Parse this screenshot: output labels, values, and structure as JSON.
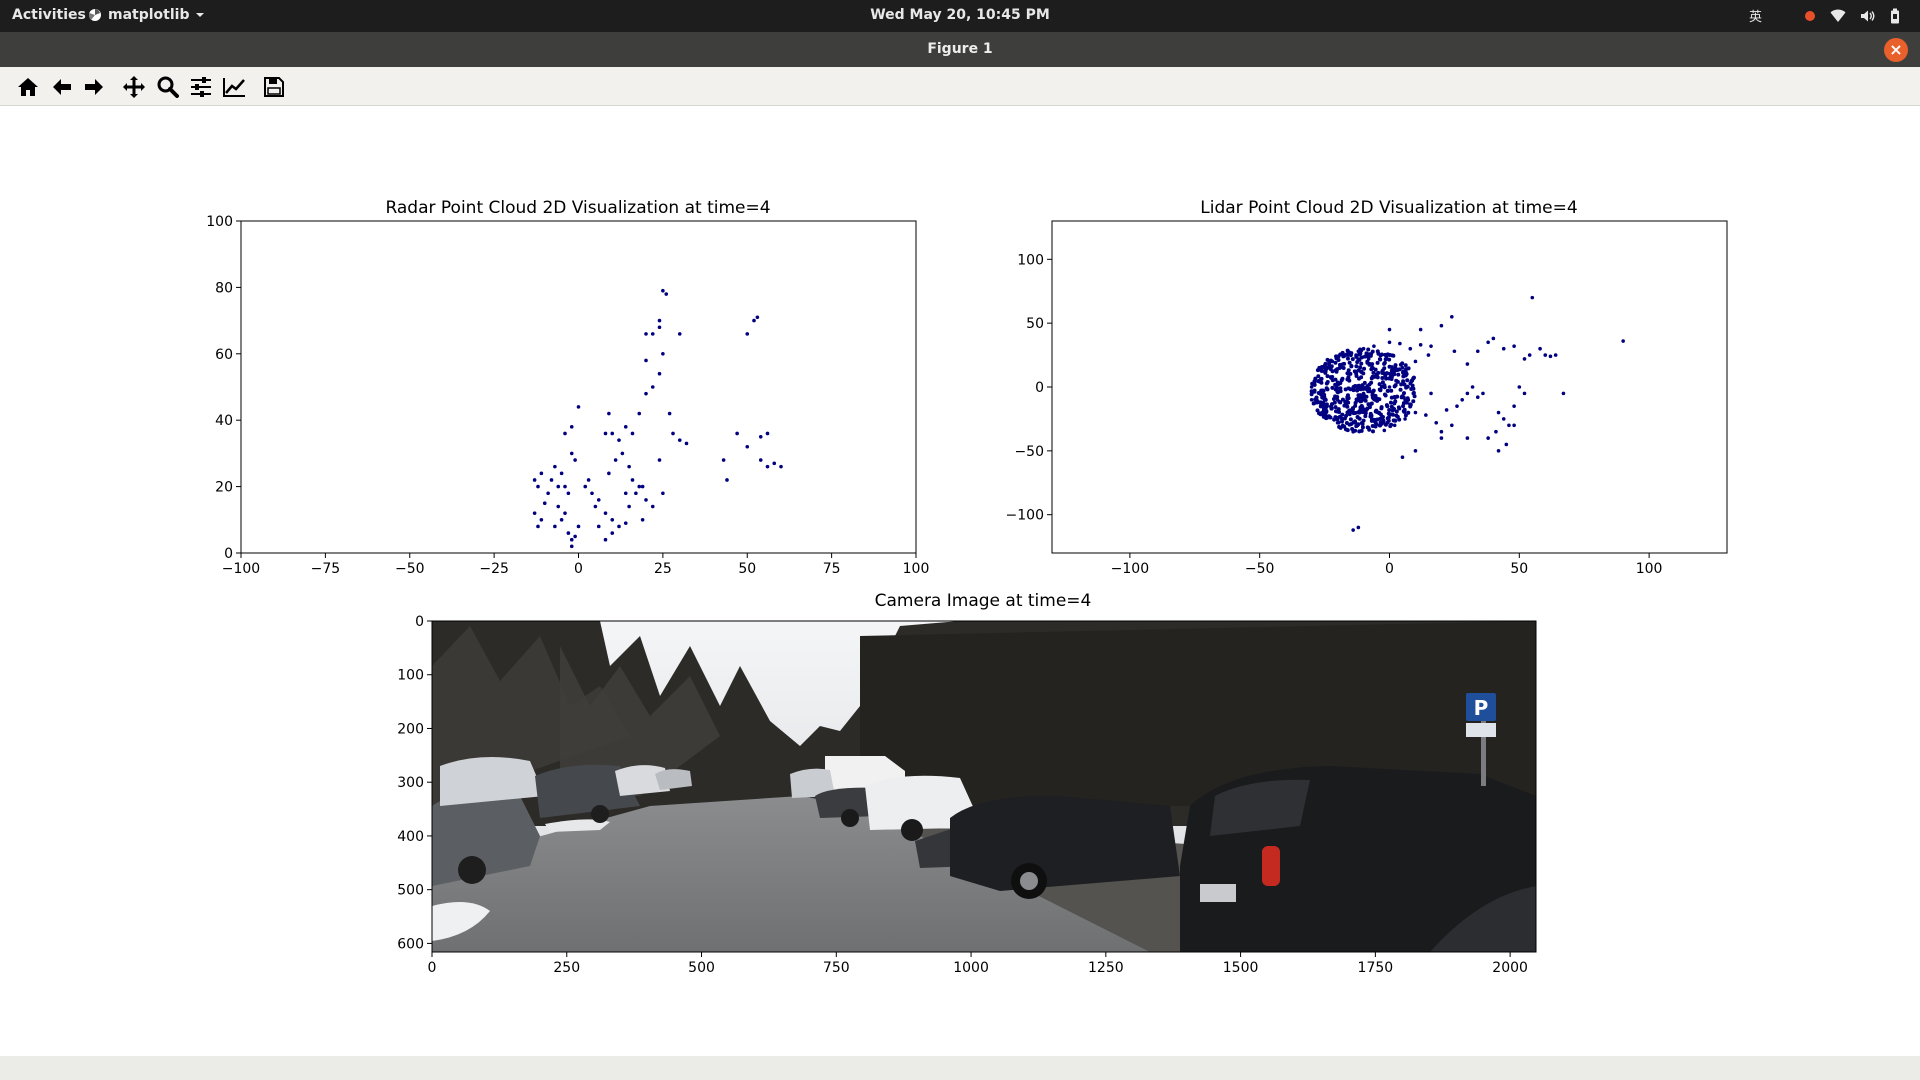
{
  "topbar": {
    "activities": "Activities",
    "app_name": "matplotlib",
    "clock": "Wed May 20, 10:45 PM",
    "input_method": "英",
    "icons": [
      "record-indicator-icon",
      "wifi-icon",
      "volume-icon",
      "battery-icon"
    ]
  },
  "window": {
    "title": "Figure 1",
    "close_symbol": "×"
  },
  "toolbar": {
    "buttons": [
      "home-icon",
      "back-arrow-icon",
      "forward-arrow-icon",
      "pan-icon",
      "zoom-icon",
      "subplots-config-icon",
      "axes-edit-icon",
      "save-icon"
    ]
  },
  "figure": {
    "radar_title": "Radar Point Cloud 2D Visualization at time=4",
    "lidar_title": "Lidar Point Cloud 2D Visualization at time=4",
    "camera_title": "Camera Image at time=4"
  },
  "chart_data": [
    {
      "type": "scatter",
      "title": "Radar Point Cloud 2D Visualization at time=4",
      "xlim": [
        -100,
        100
      ],
      "ylim": [
        0,
        100
      ],
      "xticks": [
        "−100",
        "−75",
        "−50",
        "−25",
        "0",
        "25",
        "50",
        "75",
        "100"
      ],
      "yticks": [
        "0",
        "20",
        "40",
        "60",
        "80",
        "100"
      ],
      "color": "#000080",
      "points": [
        [
          -12,
          8
        ],
        [
          -11,
          10
        ],
        [
          -13,
          12
        ],
        [
          -10,
          15
        ],
        [
          -9,
          18
        ],
        [
          -12,
          20
        ],
        [
          -8,
          22
        ],
        [
          -6,
          14
        ],
        [
          -5,
          10
        ],
        [
          -4,
          12
        ],
        [
          -3,
          6
        ],
        [
          -2,
          4
        ],
        [
          -2,
          2
        ],
        [
          -1,
          5
        ],
        [
          0,
          8
        ],
        [
          -3,
          18
        ],
        [
          -4,
          20
        ],
        [
          -5,
          24
        ],
        [
          -7,
          26
        ],
        [
          -2,
          30
        ],
        [
          -1,
          28
        ],
        [
          2,
          20
        ],
        [
          3,
          22
        ],
        [
          4,
          18
        ],
        [
          5,
          14
        ],
        [
          6,
          16
        ],
        [
          8,
          12
        ],
        [
          10,
          10
        ],
        [
          12,
          8
        ],
        [
          14,
          9
        ],
        [
          8,
          4
        ],
        [
          10,
          6
        ],
        [
          6,
          8
        ],
        [
          9,
          24
        ],
        [
          11,
          28
        ],
        [
          12,
          34
        ],
        [
          10,
          36
        ],
        [
          13,
          30
        ],
        [
          15,
          26
        ],
        [
          16,
          22
        ],
        [
          17,
          18
        ],
        [
          15,
          14
        ],
        [
          18,
          20
        ],
        [
          20,
          16
        ],
        [
          22,
          14
        ],
        [
          19,
          10
        ],
        [
          -4,
          36
        ],
        [
          -2,
          38
        ],
        [
          0,
          44
        ],
        [
          8,
          36
        ],
        [
          9,
          42
        ],
        [
          14,
          38
        ],
        [
          16,
          36
        ],
        [
          18,
          42
        ],
        [
          20,
          48
        ],
        [
          22,
          50
        ],
        [
          24,
          54
        ],
        [
          25,
          60
        ],
        [
          20,
          58
        ],
        [
          20,
          66
        ],
        [
          24,
          68
        ],
        [
          24,
          70
        ],
        [
          26,
          78
        ],
        [
          25,
          79
        ],
        [
          30,
          66
        ],
        [
          22,
          66
        ],
        [
          28,
          36
        ],
        [
          30,
          34
        ],
        [
          32,
          33
        ],
        [
          27,
          42
        ],
        [
          19,
          20
        ],
        [
          25,
          18
        ],
        [
          14,
          18
        ],
        [
          24,
          28
        ],
        [
          44,
          22
        ],
        [
          43,
          28
        ],
        [
          47,
          36
        ],
        [
          50,
          32
        ],
        [
          54,
          28
        ],
        [
          56,
          26
        ],
        [
          58,
          27
        ],
        [
          60,
          26
        ],
        [
          54,
          35
        ],
        [
          56,
          36
        ],
        [
          52,
          70
        ],
        [
          53,
          71
        ],
        [
          50,
          66
        ],
        [
          -11,
          24
        ],
        [
          -13,
          22
        ],
        [
          -6,
          20
        ],
        [
          -7,
          8
        ]
      ]
    },
    {
      "type": "scatter",
      "title": "Lidar Point Cloud 2D Visualization at time=4",
      "xlim": [
        -130,
        130
      ],
      "ylim": [
        -130,
        130
      ],
      "xticks": [
        "−100",
        "−50",
        "0",
        "50",
        "100"
      ],
      "yticks": [
        "−100",
        "−50",
        "0",
        "50",
        "100"
      ],
      "color": "#000080",
      "dense_region": {
        "x": [
          -30,
          10
        ],
        "y": [
          -35,
          30
        ]
      },
      "points": [
        [
          -30,
          0
        ],
        [
          -28,
          -10
        ],
        [
          -27,
          5
        ],
        [
          -25,
          15
        ],
        [
          -24,
          -15
        ],
        [
          -22,
          20
        ],
        [
          -20,
          -28
        ],
        [
          -18,
          -30
        ],
        [
          -16,
          25
        ],
        [
          -14,
          -35
        ],
        [
          -12,
          28
        ],
        [
          -10,
          30
        ],
        [
          -8,
          -32
        ],
        [
          -6,
          32
        ],
        [
          -4,
          -20
        ],
        [
          -2,
          -34
        ],
        [
          0,
          35
        ],
        [
          2,
          -30
        ],
        [
          4,
          34
        ],
        [
          6,
          -25
        ],
        [
          8,
          30
        ],
        [
          10,
          -20
        ],
        [
          12,
          33
        ],
        [
          14,
          -22
        ],
        [
          16,
          32
        ],
        [
          18,
          -28
        ],
        [
          20,
          -35
        ],
        [
          22,
          -18
        ],
        [
          24,
          -30
        ],
        [
          26,
          -15
        ],
        [
          28,
          -10
        ],
        [
          30,
          -5
        ],
        [
          32,
          0
        ],
        [
          34,
          -8
        ],
        [
          36,
          -5
        ],
        [
          38,
          35
        ],
        [
          40,
          38
        ],
        [
          42,
          -20
        ],
        [
          44,
          -25
        ],
        [
          46,
          -30
        ],
        [
          48,
          -15
        ],
        [
          50,
          0
        ],
        [
          52,
          -5
        ],
        [
          54,
          25
        ],
        [
          55,
          70
        ],
        [
          58,
          30
        ],
        [
          60,
          25
        ],
        [
          62,
          24
        ],
        [
          64,
          25
        ],
        [
          67,
          -5
        ],
        [
          38,
          -40
        ],
        [
          41,
          -35
        ],
        [
          30,
          -40
        ],
        [
          20,
          -40
        ],
        [
          10,
          -50
        ],
        [
          5,
          -55
        ],
        [
          -15,
          -20
        ],
        [
          -20,
          -10
        ],
        [
          -10,
          -5
        ],
        [
          0,
          0
        ],
        [
          -5,
          10
        ],
        [
          5,
          15
        ],
        [
          10,
          20
        ],
        [
          15,
          25
        ],
        [
          25,
          28
        ],
        [
          -30,
          -10
        ],
        [
          -26,
          -20
        ],
        [
          -12,
          -110
        ],
        [
          -14,
          -112
        ],
        [
          90,
          36
        ],
        [
          24,
          55
        ],
        [
          20,
          48
        ],
        [
          12,
          45
        ],
        [
          0,
          45
        ],
        [
          -22,
          8
        ],
        [
          -18,
          18
        ],
        [
          -25,
          -8
        ],
        [
          -8,
          22
        ],
        [
          6,
          -10
        ],
        [
          16,
          -5
        ],
        [
          30,
          18
        ],
        [
          34,
          28
        ],
        [
          44,
          30
        ],
        [
          48,
          32
        ],
        [
          52,
          22
        ],
        [
          48,
          -30
        ],
        [
          45,
          -45
        ],
        [
          42,
          -50
        ]
      ]
    }
  ],
  "camera_axes": {
    "xlim": [
      0,
      2048
    ],
    "ylim": [
      0,
      616
    ],
    "xticks": [
      "0",
      "250",
      "500",
      "750",
      "1000",
      "1250",
      "1500",
      "1750",
      "2000"
    ],
    "yticks": [
      "0",
      "100",
      "200",
      "300",
      "400",
      "500",
      "600"
    ],
    "sign_letter": "P"
  }
}
